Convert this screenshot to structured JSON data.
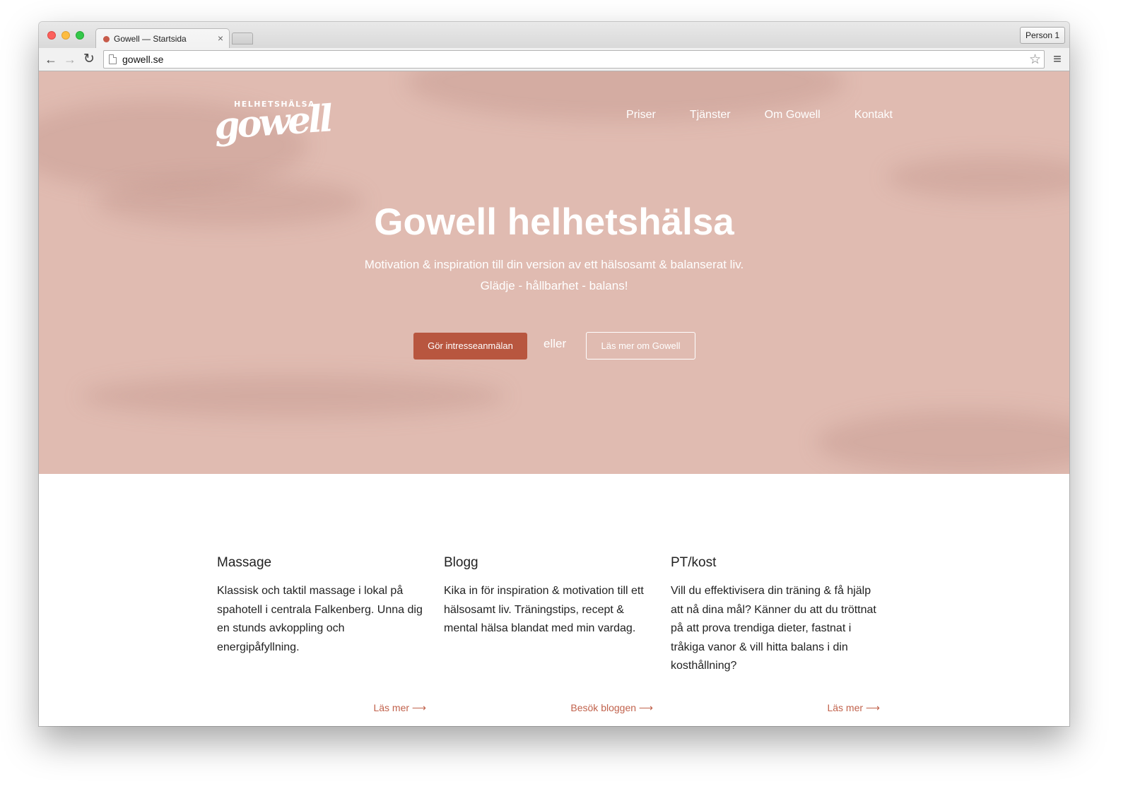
{
  "browser": {
    "tab_title": "Gowell — Startsida",
    "tab_close": "×",
    "profile": "Person 1",
    "url": "gowell.se",
    "icons": {
      "back": "back-arrow-icon",
      "forward": "forward-arrow-icon",
      "reload": "reload-icon",
      "star": "bookmark-star-icon",
      "menu": "hamburger-menu-icon"
    },
    "glyphs": {
      "back": "←",
      "forward": "→",
      "reload": "↻",
      "star": "☆",
      "menu": "≡"
    }
  },
  "site": {
    "logo_small": "HELHETSHÄLSA",
    "logo_big": "gowell",
    "nav": [
      "Priser",
      "Tjänster",
      "Om Gowell",
      "Kontakt"
    ],
    "hero": {
      "title": "Gowell helhetshälsa",
      "subtitle_line1": "Motivation & inspiration till din version av ett hälsosamt & balanserat liv.",
      "subtitle_line2": "Glädje - hållbarhet - balans!",
      "cta_primary": "Gör intresseanmälan",
      "cta_or": "eller",
      "cta_secondary": "Läs mer om Gowell"
    },
    "colors": {
      "hero_bg": "#e0bbb1",
      "accent": "#b8563f",
      "link": "#c1624c"
    },
    "features": [
      {
        "title": "Massage",
        "text": "Klassisk och taktil massage i lokal på spahotell i centrala Falkenberg. Unna dig en stunds avkoppling och energipåfyllning.",
        "link": "Läs mer"
      },
      {
        "title": "Blogg",
        "text": "Kika in för inspiration & motivation till ett hälsosamt liv. Träningstips, recept & mental hälsa blandat med min vardag.",
        "link": "Besök bloggen"
      },
      {
        "title": "PT/kost",
        "text": "Vill du effektivisera din träning & få hjälp att nå dina mål? Känner du att du tröttnat på att prova trendiga dieter, fastnat i tråkiga vanor & vill hitta balans i din kosthållning?",
        "link": "Läs mer"
      }
    ],
    "link_arrow": "⟶"
  }
}
